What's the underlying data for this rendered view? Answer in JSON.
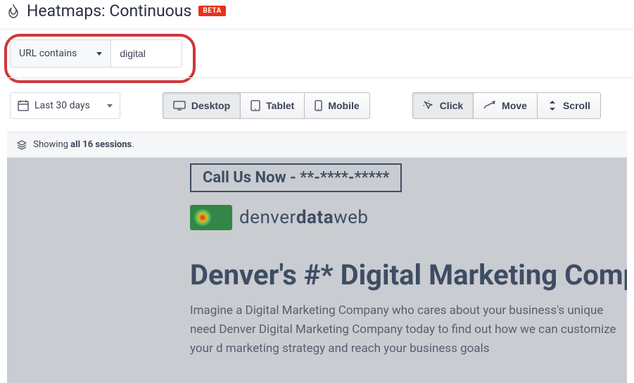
{
  "header": {
    "title": "Heatmaps: Continuous",
    "badge": "BETA"
  },
  "filter": {
    "mode_label": "URL contains",
    "value": "digital"
  },
  "toolbar": {
    "date_label": "Last 30 days",
    "devices": {
      "desktop": "Desktop",
      "tablet": "Tablet",
      "mobile": "Mobile"
    },
    "maps": {
      "click": "Click",
      "move": "Move",
      "scroll": "Scroll"
    }
  },
  "sessions": {
    "prefix": "Showing ",
    "bold": "all 16 sessions",
    "suffix": "."
  },
  "preview": {
    "callus": "Call Us Now - **-****-*****",
    "logo_pre": "denver",
    "logo_bold": "data",
    "logo_post": "web",
    "hero_title": "Denver's #* Digital Marketing Comp",
    "hero_body": "Imagine a Digital Marketing Company who cares about your business's unique need Denver Digital Marketing Company today to find out how we can customize your d marketing strategy and reach your business goals"
  }
}
